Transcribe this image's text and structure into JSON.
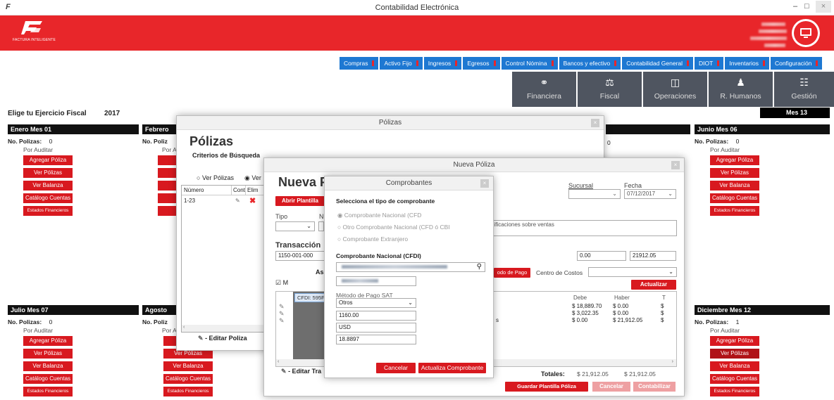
{
  "window": {
    "title": "Contabilidad Electrónica",
    "controls": [
      "–",
      "□",
      "×"
    ]
  },
  "brand": {
    "logo_text": "FACTURA INTELIGENTE"
  },
  "nav_tabs": [
    "Compras",
    "Activo Fijo",
    "Ingresos",
    "Egresos",
    "Control Nómina",
    "Bancos y efectivo",
    "Contabilidad General",
    "DIOT",
    "Inventarios",
    "Configuración"
  ],
  "categories": [
    {
      "label": "Financiera",
      "icon": "coins-icon"
    },
    {
      "label": "Fiscal",
      "icon": "scale-icon"
    },
    {
      "label": "Operaciones",
      "icon": "clipboard-icon"
    },
    {
      "label": "R. Humanos",
      "icon": "person-icon"
    },
    {
      "label": "Gestión",
      "icon": "org-chart-icon"
    }
  ],
  "fiscal": {
    "label": "Elige tu Ejercicio Fiscal",
    "year": "2017",
    "mes13": "Mes 13"
  },
  "months": {
    "m1": {
      "title": "Enero Mes 01",
      "polizas_label": "No. Polizas:",
      "polizas": "0",
      "status": "Por Auditar"
    },
    "m2": {
      "title": "Febrero"
    },
    "m6": {
      "title": "Junio Mes 06",
      "polizas_label": "No. Polizas:",
      "polizas": "0",
      "status": "Por Auditar"
    },
    "m7": {
      "title": "Julio Mes 07",
      "polizas_label": "No. Polizas:",
      "polizas": "0",
      "status": "Por Auditar"
    },
    "m8": {
      "title": "Agosto"
    },
    "m12": {
      "title": "Diciembre Mes 12",
      "polizas_label": "No. Polizas:",
      "polizas": "1",
      "status": "Por Auditar"
    },
    "mid_polizas": "0"
  },
  "month_buttons": [
    "Agregar Póliza",
    "Ver Pólizas",
    "Ver Balanza",
    "Catálogo Cuentas",
    "Estados Financieros"
  ],
  "partial": {
    "polizas_label": "No. Poliz",
    "por": "Por A"
  },
  "polizas_dialog": {
    "title": "Pólizas",
    "heading": "Pólizas",
    "criteria": "Criterios de Búsqueda",
    "radio1": "Ver Pólizas",
    "radio2": "Ver",
    "col_num": "Número",
    "col_cont": "Cont",
    "col_elim": "Elim",
    "row_num": "1-23",
    "edit_label": "- Editar Poliza"
  },
  "nueva": {
    "title": "Nueva Póliza",
    "heading": "Nueva P",
    "abrir": "Abrir Plantilla",
    "tipo": "Tipo",
    "n": "N",
    "sucursal": "Sucursal",
    "fecha": "Fecha",
    "fecha_val": "07/12/2017",
    "concepto": "nificaciones sobre ventas",
    "transaccion": "Transacción",
    "trans_val": "1150-001-000",
    "amount1": "0.00",
    "amount2": "21912.05",
    "as": "As",
    "metodo_pago": "odo de Pago",
    "centro": "Centro de Costos",
    "actualizar": "Actualizar",
    "check_m": "M",
    "cfdi": "CFDI: 595F",
    "col_debe": "Debe",
    "col_haber": "Haber",
    "col_t": "T",
    "rows": [
      {
        "debe": "$ 18,889.70",
        "haber": "$ 0.00",
        "t": "$"
      },
      {
        "debe": "$ 3,022.35",
        "haber": "$ 0.00",
        "t": "$"
      },
      {
        "debe": "$ 0.00",
        "haber": "$ 21,912.05",
        "t": "$"
      }
    ],
    "s": "s",
    "totales": "Totales:",
    "tot_debe": "$ 21,912.05",
    "tot_haber": "$ 21,912.05",
    "editar_tra": "- Editar Tra",
    "guardar": "Guardar Plantilla Póliza",
    "cancelar": "Cancelar",
    "contabilizar": "Contabilizar"
  },
  "comprobantes": {
    "title": "Comprobantes",
    "heading": "Selecciona el tipo de comprobante",
    "opt1": "Comprobante Nacional (CFD",
    "opt2": "Otro Comprobante Nacional (CFD ó CBI",
    "opt3": "Comprobante Extranjero",
    "section": "Comprobante Nacional (CFDI)",
    "metodo_label": "Método de Pago SAT",
    "metodo_val": "Otros",
    "monto": "1160.00",
    "moneda": "USD",
    "tipo_cambio": "18.8897",
    "cancel": "Cancelar",
    "update": "Actualiza Comprobante"
  },
  "colors": {
    "red": "#e8262a",
    "blue": "#1e78d2",
    "dark": "#4f5560"
  }
}
